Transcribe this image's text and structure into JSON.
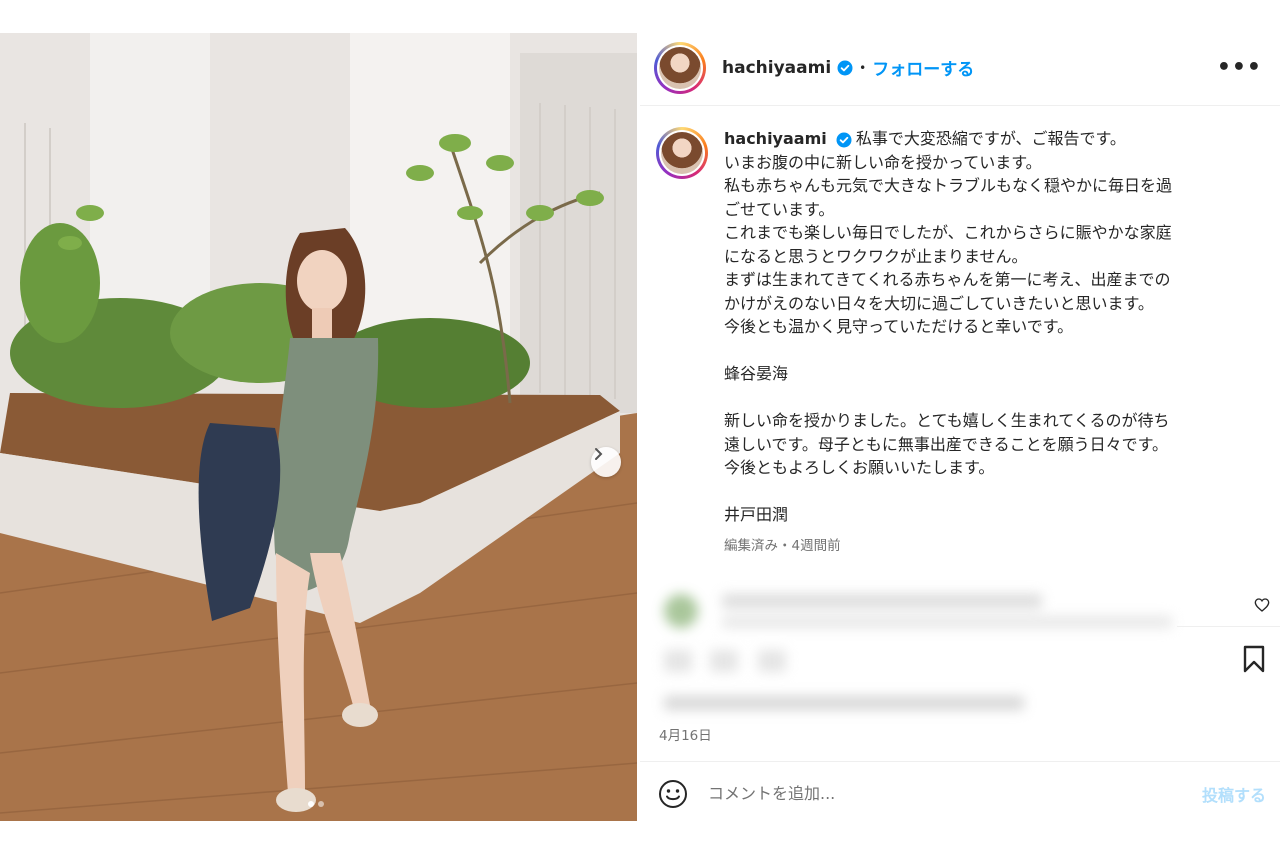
{
  "post": {
    "username": "hachiyaami",
    "follow_label": "フォローする",
    "separator": "•",
    "more_label": "•••"
  },
  "caption": {
    "username": "hachiyaami",
    "lines": [
      "私事で大変恐縮ですが、ご報告です。",
      "いまお腹の中に新しい命を授かっています。",
      "私も赤ちゃんも元気で大きなトラブルもなく穏やかに毎日を過",
      "ごせています。",
      "これまでも楽しい毎日でしたが、これからさらに賑やかな家庭",
      "になると思うとワクワクが止まりません。",
      "まずは生まれてきてくれる赤ちゃんを第一に考え、出産までの",
      "かけがえのない日々を大切に過ごしていきたいと思います。",
      "今後とも温かく見守っていただけると幸いです。",
      "",
      "蜂谷晏海",
      "",
      "新しい命を授かりました。とても嬉しく生まれてくるのが待ち",
      "遠しいです。母子ともに無事出産できることを願う日々です。",
      "今後ともよろしくお願いいたします。",
      "",
      "井戸田潤"
    ],
    "meta": "編集済み・4週間前"
  },
  "date": "4月16日",
  "comment": {
    "placeholder": "コメントを追加...",
    "post_label": "投稿する"
  },
  "colors": {
    "link": "#0095f6",
    "post_disabled": "#b2dffc",
    "muted": "#737373",
    "verified": "#0095f6"
  },
  "icons": [
    "verified-badge-icon",
    "more-options-icon",
    "chevron-right-icon",
    "heart-icon",
    "bookmark-icon",
    "emoji-icon"
  ],
  "carousel": {
    "current": 1,
    "total": 2
  }
}
